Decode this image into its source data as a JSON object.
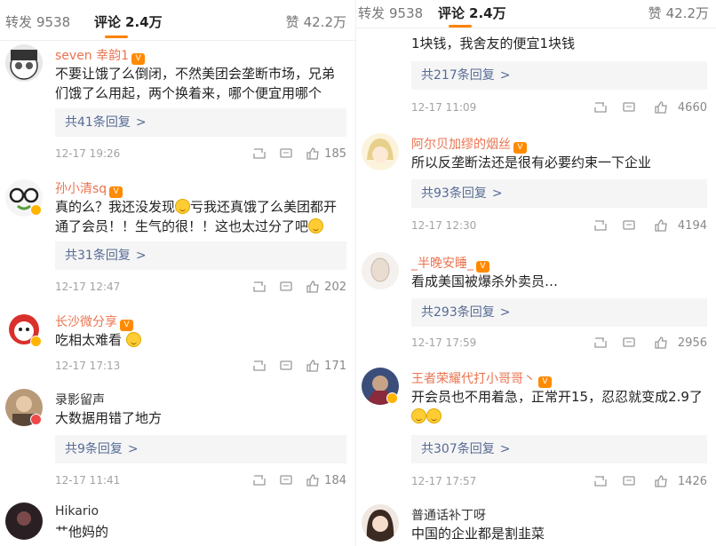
{
  "panels": [
    {
      "tabs": {
        "repost_label": "转发",
        "repost_count": "9538",
        "comment_label": "评论",
        "comment_count": "2.4万",
        "like_label": "赞",
        "like_count": "42.2万"
      },
      "comments": [
        {
          "username": "seven 幸韵1",
          "text": "不要让饿了么倒闭，不然美团会垄断市场，兄弟们饿了么用起，两个换着来，哪个便宜用哪个",
          "reply_text": "共41条回复",
          "time": "12-17 19:26",
          "likes": "185",
          "avatar_icon": "glasses-cartoon-avatar"
        },
        {
          "username": "孙小清sq",
          "text_parts": [
            "真的么？我还没发现",
            "亏我还真饿了么美团都开通了会员！！生气的很！！这也太过分了吧"
          ],
          "reply_text": "共31条回复",
          "time": "12-17 12:47",
          "likes": "202",
          "avatar_icon": "round-glasses-avatar"
        },
        {
          "username": "长沙微分享",
          "text": "吃相太难看",
          "reply_text": "",
          "time": "12-17 17:13",
          "likes": "171",
          "avatar_icon": "cartoon-red-avatar"
        },
        {
          "username": "录影留声",
          "text": "大数据用错了地方",
          "reply_text": "共9条回复",
          "time": "12-17 11:41",
          "likes": "184",
          "avatar_icon": "photo-avatar"
        },
        {
          "username": "Hikario",
          "text": "艹他妈的",
          "avatar_icon": "dark-photo-avatar"
        }
      ]
    },
    {
      "tabs": {
        "repost_label": "转发",
        "repost_count": "9538",
        "comment_label": "评论",
        "comment_count": "2.4万",
        "like_label": "赞",
        "like_count": "42.2万"
      },
      "comments": [
        {
          "username": "",
          "text": "1块钱，我舍友的便宜1块钱",
          "reply_text": "共217条回复",
          "time": "12-17 11:09",
          "likes": "4660"
        },
        {
          "username": "阿尔贝加缪的烟丝",
          "text": "所以反垄断法还是很有必要约束一下企业",
          "reply_text": "共93条回复",
          "time": "12-17 12:30",
          "likes": "4194",
          "avatar_icon": "anime-girl-avatar"
        },
        {
          "username": "_半晚安睡_",
          "text": "看成美国被爆杀外卖员…",
          "reply_text": "共293条回复",
          "time": "12-17 17:59",
          "likes": "2956",
          "avatar_icon": "sketch-avatar"
        },
        {
          "username": "王者荣耀代打小哥哥丶",
          "text": "开会员也不用着急，正常开15，忍忍就变成2.9了",
          "reply_text": "共307条回复",
          "time": "12-17 17:57",
          "likes": "1426",
          "avatar_icon": "game-hero-avatar"
        },
        {
          "username": "普通话补丁呀",
          "text": "中国的企业都是割韭菜",
          "avatar_icon": "girl-photo-avatar"
        }
      ]
    }
  ],
  "colors": {
    "accent": "#ff8200",
    "username": "#eb7350",
    "reply_link": "#576b95",
    "meta": "#a3a3a3"
  },
  "icons": {
    "repost": "repost-icon",
    "comment": "comment-icon",
    "like": "thumbs-up-icon",
    "reply_chevron": ">"
  }
}
